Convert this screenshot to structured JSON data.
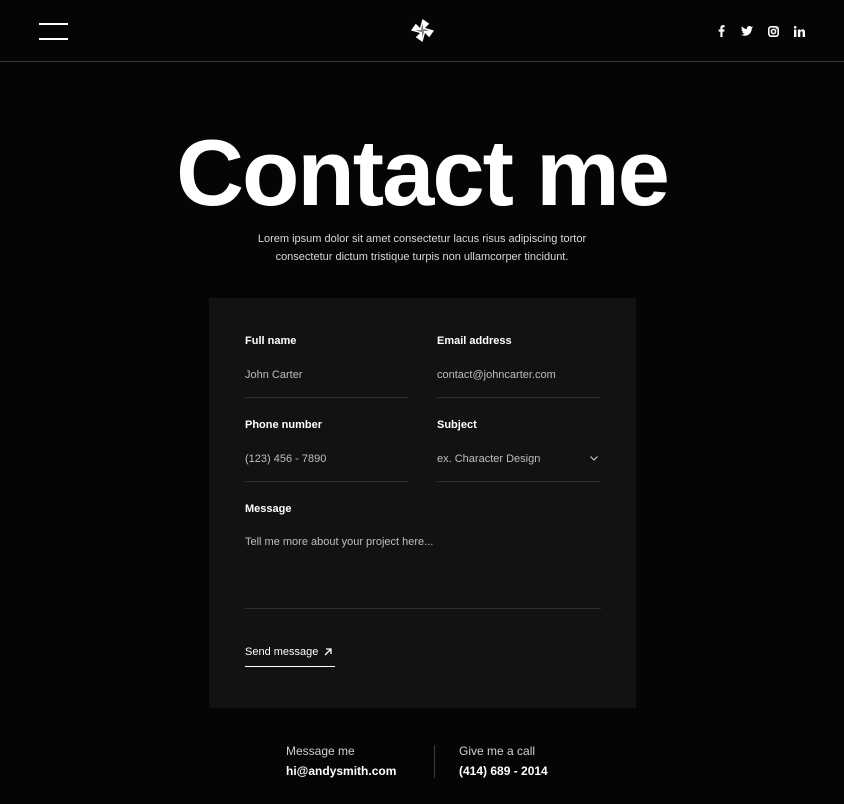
{
  "header": {
    "socials": [
      {
        "icon": "facebook-icon"
      },
      {
        "icon": "twitter-icon"
      },
      {
        "icon": "instagram-icon"
      },
      {
        "icon": "linkedin-icon"
      }
    ]
  },
  "hero": {
    "title": "Contact me",
    "subtitle": "Lorem ipsum dolor sit amet consectetur lacus risus adipiscing tortor consectetur dictum tristique turpis non ullamcorper tincidunt."
  },
  "form": {
    "full_name": {
      "label": "Full name",
      "placeholder": "John Carter"
    },
    "email": {
      "label": "Email address",
      "placeholder": "contact@johncarter.com"
    },
    "phone": {
      "label": "Phone number",
      "placeholder": "(123) 456 - 7890"
    },
    "subject": {
      "label": "Subject",
      "placeholder": "ex. Character Design"
    },
    "message": {
      "label": "Message",
      "placeholder": "Tell me more about your project here..."
    },
    "send_label": "Send message"
  },
  "contact": {
    "message_label": "Message me",
    "message_value": "hi@andysmith.com",
    "call_label": "Give me a call",
    "call_value": "(414) 689 - 2014"
  },
  "colors": {
    "background": "#050505",
    "card": "#121212",
    "text": "#ffffff"
  }
}
